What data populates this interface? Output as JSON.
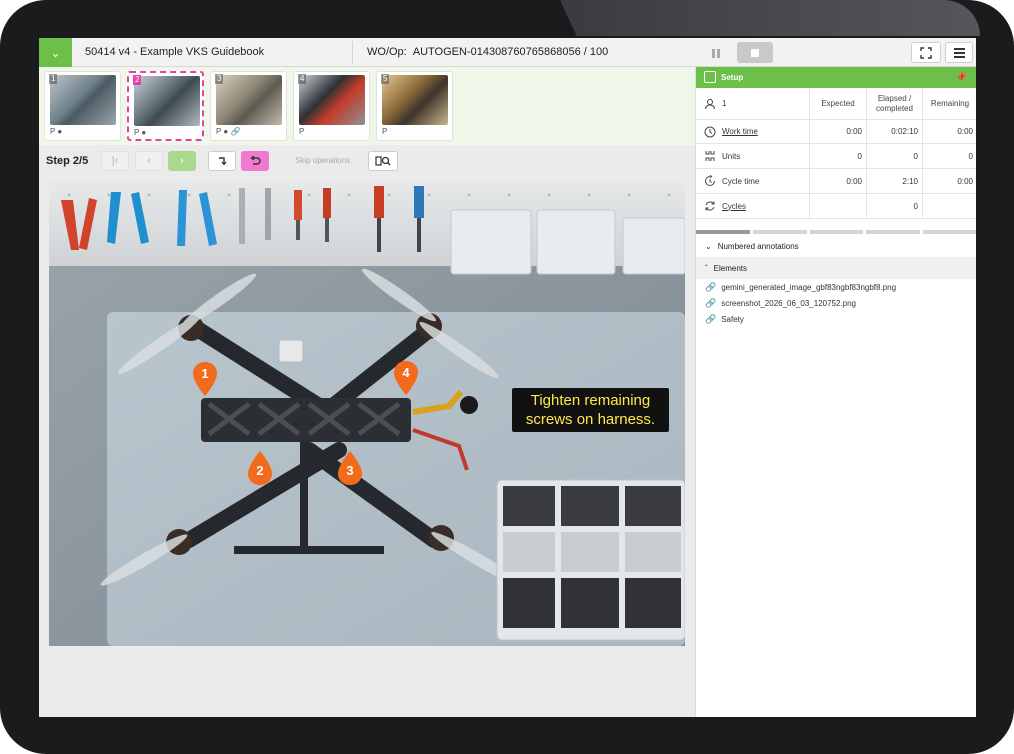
{
  "header": {
    "title": "50414 v4 - Example VKS Guidebook",
    "wo_label": "WO/Op:",
    "wo_value": "AUTOGEN-014308760765868056 / 100"
  },
  "thumbnails": [
    {
      "num": "1",
      "flags": "P ●"
    },
    {
      "num": "2",
      "flags": "P ●"
    },
    {
      "num": "3",
      "flags": "P ● 🔗"
    },
    {
      "num": "4",
      "flags": "P"
    },
    {
      "num": "5",
      "flags": "P"
    }
  ],
  "stepbar": {
    "step_label": "Step 2/5",
    "skip_label": "Skip operations"
  },
  "callout": {
    "line1": "Tighten remaining",
    "line2": "screws on harness."
  },
  "pins": [
    "1",
    "2",
    "3",
    "4"
  ],
  "setup": {
    "title": "Setup",
    "operator_count": "1",
    "columns": [
      "Expected",
      "Elapsed / completed",
      "Remaining"
    ],
    "rows": [
      {
        "label": "Work time",
        "expected": "0:00",
        "elapsed": "0:02:10",
        "remaining": "0:00"
      },
      {
        "label": "Units",
        "expected": "0",
        "elapsed": "0",
        "remaining": "0"
      },
      {
        "label": "Cycle time",
        "expected": "0:00",
        "elapsed": "2:10",
        "remaining": "0:00"
      },
      {
        "label": "Cycles",
        "expected": "",
        "elapsed": "0",
        "remaining": ""
      }
    ]
  },
  "sections": {
    "annotations": "Numbered annotations",
    "elements": "Elements"
  },
  "elements": [
    "gemini_generated_image_gbf83ngbf83ngbf8.png",
    "screenshot_2026_06_03_120752.png",
    "Safety"
  ],
  "colors": {
    "accent": "#6cc04a",
    "highlight": "#e83fa8",
    "pin": "#f26a1b",
    "callout_text": "#ffe84a"
  }
}
